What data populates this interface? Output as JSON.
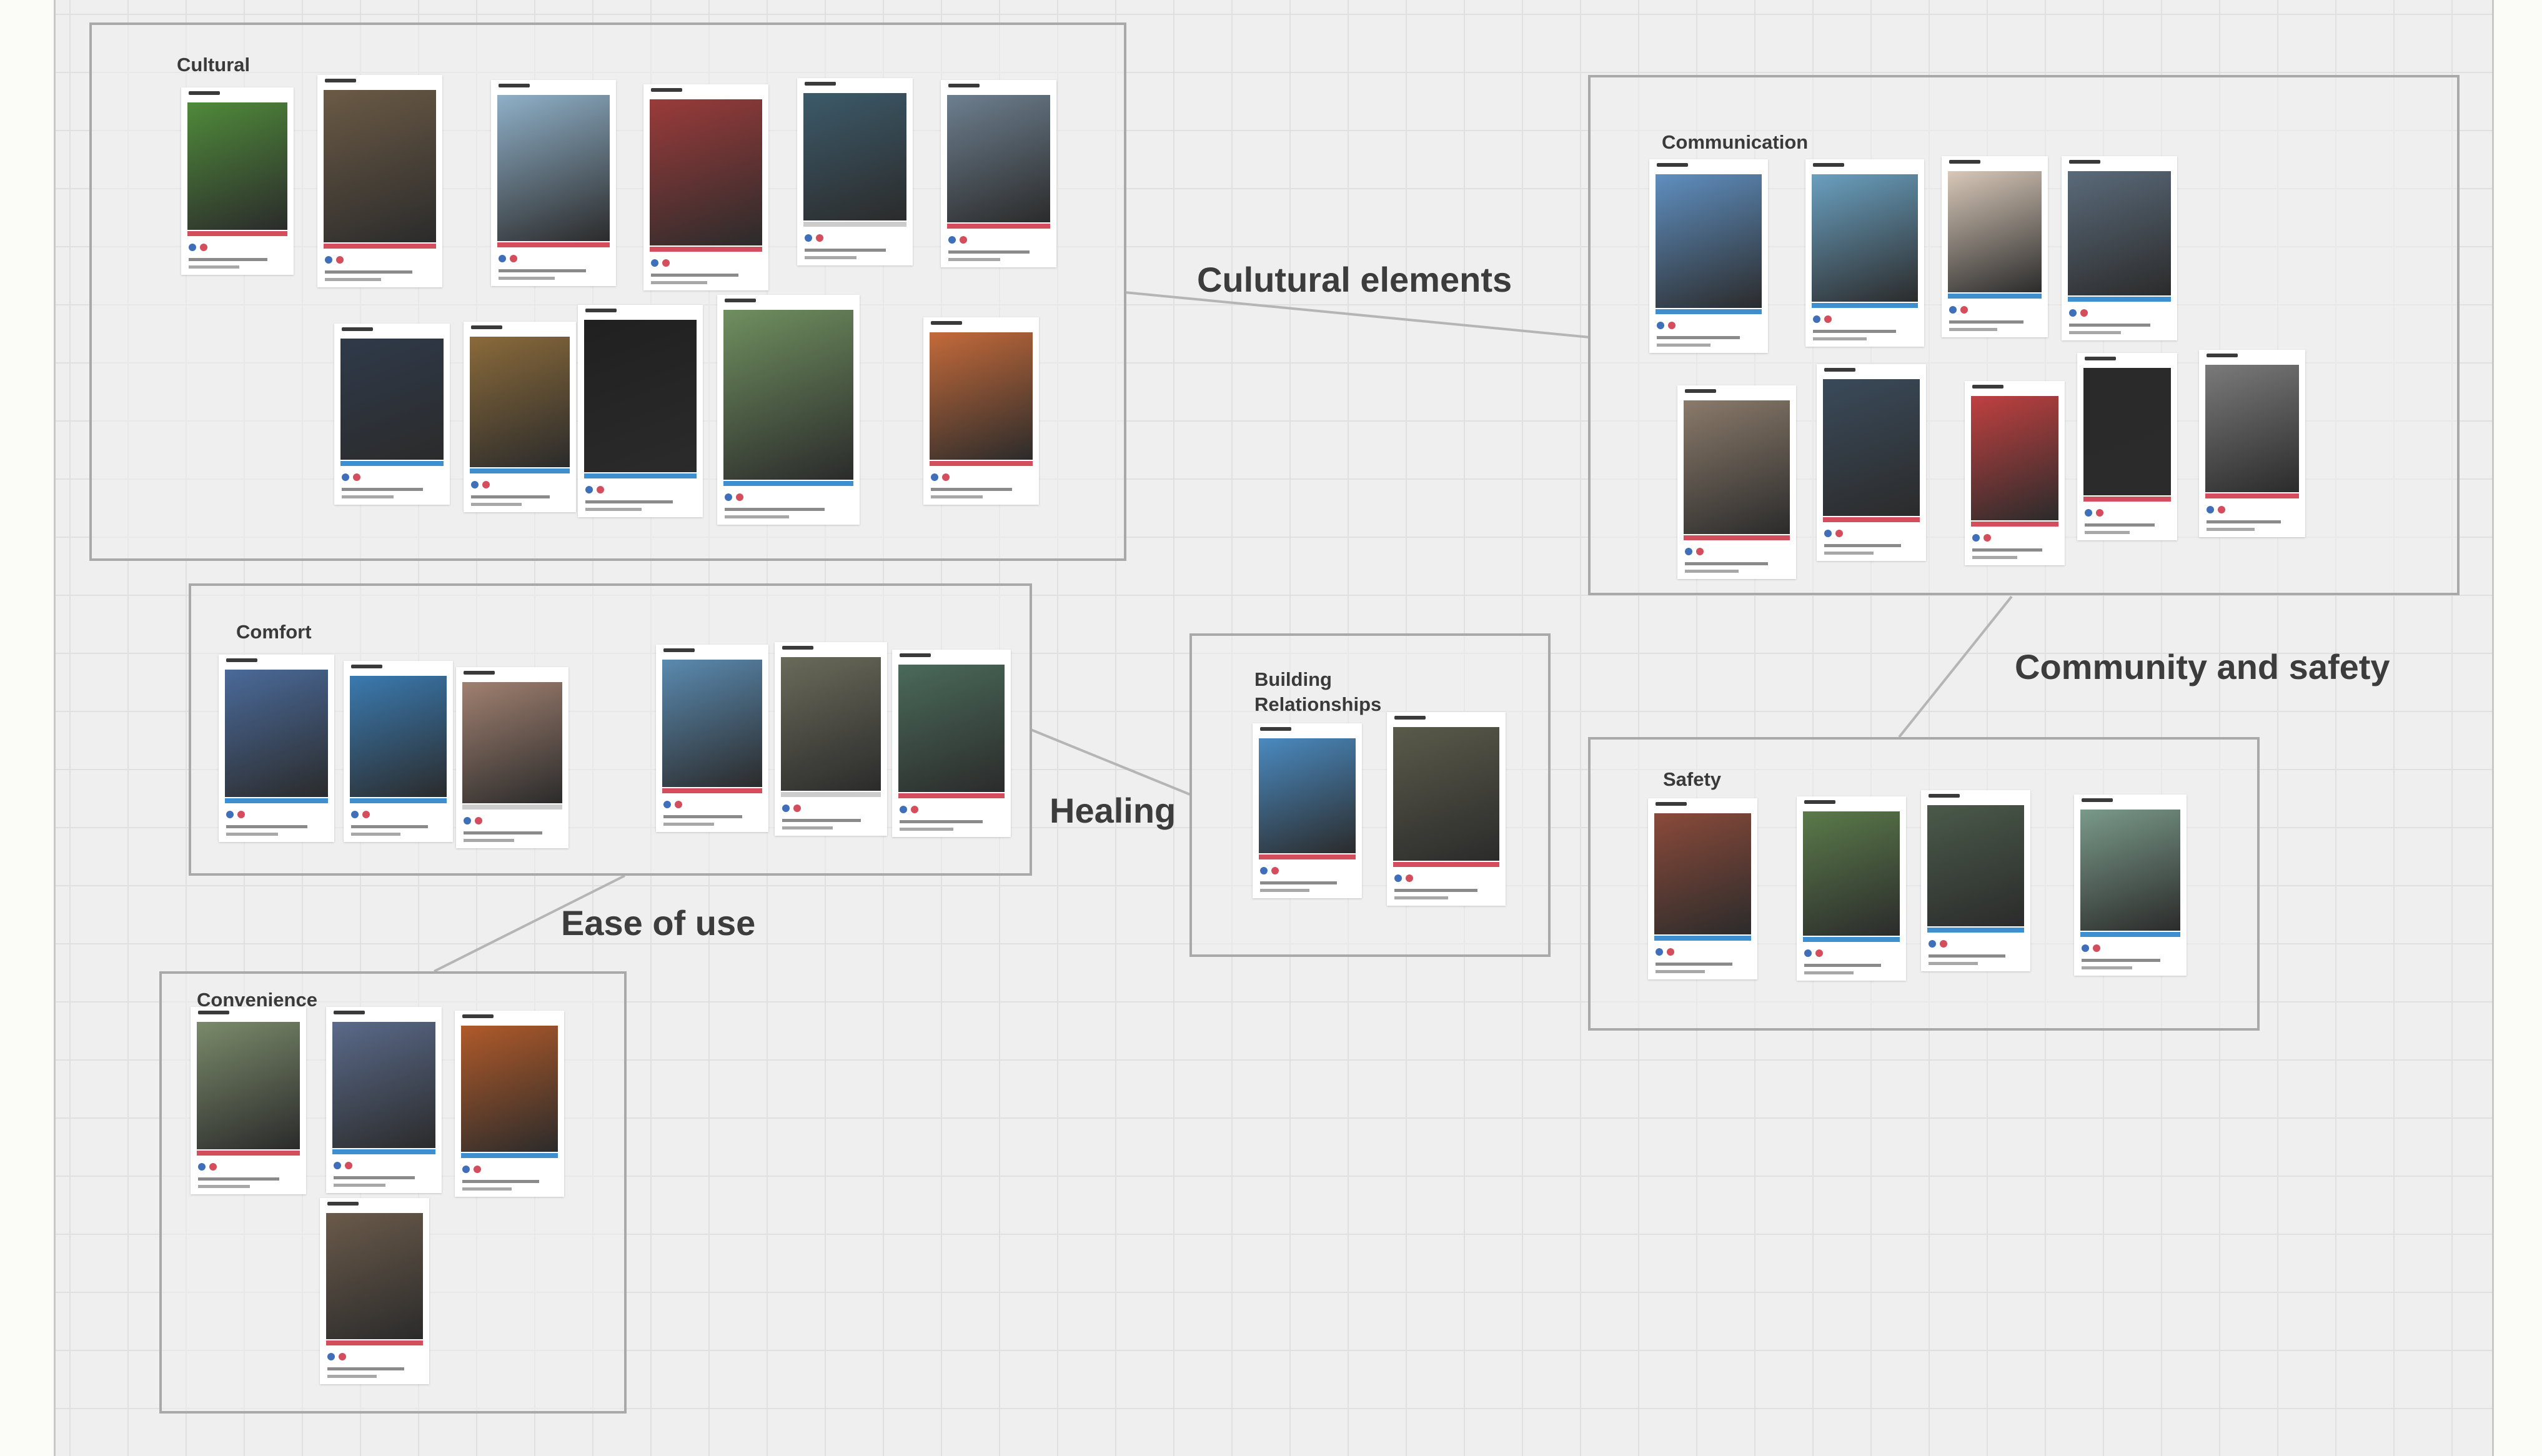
{
  "groups": {
    "cultural": "Cultural",
    "communication": "Communication",
    "comfort": "Comfort",
    "building": "Building\nRelationships",
    "safety": "Safety",
    "convenience": "Convenience"
  },
  "themes": {
    "cultural_elements": "Culutural elements",
    "community_safety": "Community and safety",
    "healing": "Healing",
    "ease_of_use": "Ease of use"
  },
  "colors": {
    "board": "#efefef",
    "group_border": "#a9a9a9",
    "accent_red": "#d44d5c",
    "accent_blue": "#3e8fd0"
  },
  "cards": [
    {
      "group": "cultural",
      "photo": "#4f8a3a",
      "bar": "#d44d5c"
    },
    {
      "group": "cultural",
      "photo": "#6b5a45",
      "bar": "#d44d5c"
    },
    {
      "group": "cultural",
      "photo": "#8fb0c8",
      "bar": "#d44d5c"
    },
    {
      "group": "cultural",
      "photo": "#9a3b3a",
      "bar": "#d44d5c"
    },
    {
      "group": "cultural",
      "photo": "#3c5a6a",
      "bar": "#cccccc"
    },
    {
      "group": "cultural",
      "photo": "#6d7f8f",
      "bar": "#d44d5c"
    },
    {
      "group": "cultural",
      "photo": "#2f3a4a",
      "bar": "#3e8fd0"
    },
    {
      "group": "cultural",
      "photo": "#8a6a3a",
      "bar": "#3e8fd0"
    },
    {
      "group": "cultural",
      "photo": "#202020",
      "bar": "#3e8fd0"
    },
    {
      "group": "cultural",
      "photo": "#6f8f5f",
      "bar": "#3e8fd0"
    },
    {
      "group": "cultural",
      "photo": "#c46a3a",
      "bar": "#d44d5c"
    },
    {
      "group": "communication",
      "photo": "#5f8fc0",
      "bar": "#3e8fd0"
    },
    {
      "group": "communication",
      "photo": "#6aa0c0",
      "bar": "#3e8fd0"
    },
    {
      "group": "communication",
      "photo": "#d8c8b8",
      "bar": "#3e8fd0"
    },
    {
      "group": "communication",
      "photo": "#5a6a7a",
      "bar": "#3e8fd0"
    },
    {
      "group": "communication",
      "photo": "#8a7a6a",
      "bar": "#d44d5c"
    },
    {
      "group": "communication",
      "photo": "#3a4a5a",
      "bar": "#d44d5c"
    },
    {
      "group": "communication",
      "photo": "#c04040",
      "bar": "#d44d5c"
    },
    {
      "group": "communication",
      "photo": "#2a2a2a",
      "bar": "#d44d5c"
    },
    {
      "group": "communication",
      "photo": "#7a7a7a",
      "bar": "#d44d5c"
    },
    {
      "group": "comfort",
      "photo": "#4a6a9a",
      "bar": "#3e8fd0"
    },
    {
      "group": "comfort",
      "photo": "#3a7ab0",
      "bar": "#3e8fd0"
    },
    {
      "group": "comfort",
      "photo": "#a08070",
      "bar": "#cccccc"
    },
    {
      "group": "comfort",
      "photo": "#5a8ab0",
      "bar": "#d44d5c"
    },
    {
      "group": "comfort",
      "photo": "#6a6a5a",
      "bar": "#cccccc"
    },
    {
      "group": "comfort",
      "photo": "#4a6a5a",
      "bar": "#d44d5c"
    },
    {
      "group": "building",
      "photo": "#4a8ac0",
      "bar": "#d44d5c"
    },
    {
      "group": "building",
      "photo": "#5a5a4a",
      "bar": "#d44d5c"
    },
    {
      "group": "safety",
      "photo": "#8a4a3a",
      "bar": "#3e8fd0"
    },
    {
      "group": "safety",
      "photo": "#5a7a4a",
      "bar": "#3e8fd0"
    },
    {
      "group": "safety",
      "photo": "#4a5a4a",
      "bar": "#3e8fd0"
    },
    {
      "group": "safety",
      "photo": "#7a9a8a",
      "bar": "#3e8fd0"
    },
    {
      "group": "convenience",
      "photo": "#7a8a6a",
      "bar": "#d44d5c"
    },
    {
      "group": "convenience",
      "photo": "#5a6a8a",
      "bar": "#3e8fd0"
    },
    {
      "group": "convenience",
      "photo": "#b05a2a",
      "bar": "#3e8fd0"
    },
    {
      "group": "convenience",
      "photo": "#6a5a4a",
      "bar": "#d44d5c"
    }
  ]
}
